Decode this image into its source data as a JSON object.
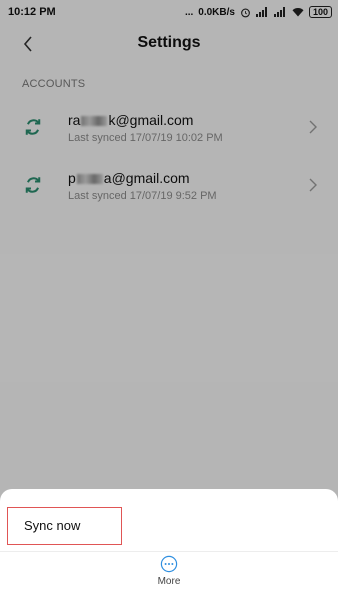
{
  "status_bar": {
    "time": "10:12 PM",
    "dots": "...",
    "speed": "0.0KB/s",
    "battery": "100"
  },
  "app_bar": {
    "title": "Settings"
  },
  "accounts": {
    "header": "ACCOUNTS",
    "items": [
      {
        "email_prefix": "ra",
        "email_suffix": "k@gmail.com",
        "last_synced": "Last synced 17/07/19 10:02 PM"
      },
      {
        "email_prefix": "p",
        "email_suffix": "a@gmail.com",
        "last_synced": "Last synced 17/07/19 9:52 PM"
      }
    ]
  },
  "sheet": {
    "sync_now_label": "Sync now",
    "more_label": "More"
  },
  "colors": {
    "sync_icon": "#2a8c6e",
    "highlight_border": "#e05555",
    "more_icon": "#2f8fe0"
  }
}
